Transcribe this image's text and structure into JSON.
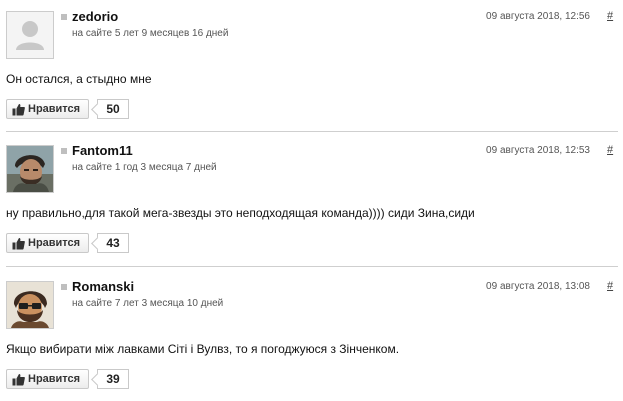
{
  "like_label": "Нравится",
  "permalink_symbol": "#",
  "colors": {
    "divider": "#cfcfcf",
    "status_square": "#bfbfbf",
    "button_border": "#c9c9c9"
  },
  "comments": [
    {
      "username": "zedorio",
      "site_age": "на сайте 5 лет 9 месяцев 16 дней",
      "timestamp": "09 августа 2018, 12:56",
      "text": "Он остался, а стыдно мне",
      "likes": "50",
      "avatar": "default-avatar-icon"
    },
    {
      "username": "Fantom11",
      "site_age": "на сайте 1 год 3 месяца 7 дней",
      "timestamp": "09 августа 2018, 12:53",
      "text": "ну правильно,для такой мега-звезды это неподходящая команда)))) сиди Зина,сиди",
      "likes": "43",
      "avatar": "user-photo"
    },
    {
      "username": "Romanski",
      "site_age": "на сайте 7 лет 3 месяца 10 дней",
      "timestamp": "09 августа 2018, 13:08",
      "text": "Якщо вибирати між лавками Сіті і Вулвз, то я погоджуюся з Зінченком.",
      "likes": "39",
      "avatar": "cartoon-avatar"
    }
  ]
}
